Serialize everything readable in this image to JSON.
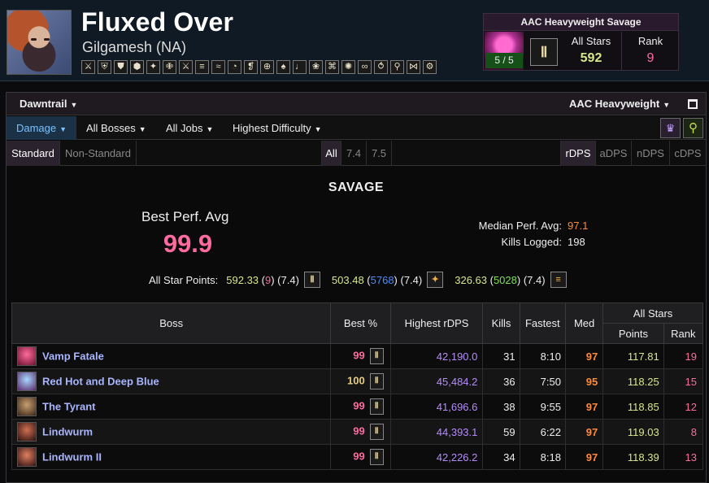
{
  "header": {
    "character_name": "Fluxed Over",
    "server": "Gilgamesh (NA)",
    "job_icons": [
      "⚔",
      "⛨",
      "⛊",
      "⬢",
      "✦",
      "✙",
      "⚔",
      "≡",
      "≈",
      "◔",
      "❡",
      "⊕",
      "♠",
      "♩",
      "❀",
      "⌘",
      "✺",
      "∞",
      "⥀",
      "⚲",
      "⋈",
      "⚙"
    ]
  },
  "stars_box": {
    "title": "AAC Heavyweight Savage",
    "progress": "5 / 5",
    "job_glyph": "Ⅱ",
    "all_stars_label": "All Stars",
    "all_stars_value": "592",
    "rank_label": "Rank",
    "rank_value": "9"
  },
  "filters": {
    "expansion": "Dawntrail",
    "zone": "AAC Heavyweight",
    "metric_tab": "Damage",
    "bosses": "All Bosses",
    "jobs": "All Jobs",
    "difficulty": "Highest Difficulty",
    "standard": "Standard",
    "non_standard": "Non-Standard",
    "patch_all": "All",
    "patch_74": "7.4",
    "patch_75": "7.5",
    "rdps": "rDPS",
    "adps": "aDPS",
    "ndps": "nDPS",
    "cdps": "cDPS"
  },
  "summary": {
    "difficulty_title": "SAVAGE",
    "best_perf_label": "Best Perf. Avg",
    "best_perf_value": "99.9",
    "median_label": "Median Perf. Avg:",
    "median_value": "97.1",
    "kills_label": "Kills Logged:",
    "kills_value": "198",
    "all_star_points_label": "All Star Points:",
    "all_star_points": [
      {
        "points": "592.33",
        "rank": "9",
        "patch": "(7.4)",
        "icon": "Ⅱ",
        "rank_color": "pink"
      },
      {
        "points": "503.48",
        "rank": "5768",
        "patch": "(7.4)",
        "icon": "✦",
        "rank_color": "blue"
      },
      {
        "points": "326.63",
        "rank": "5028",
        "patch": "(7.4)",
        "icon": "≡",
        "rank_color": "green"
      }
    ]
  },
  "table": {
    "headers": {
      "boss": "Boss",
      "best": "Best %",
      "highest": "Highest rDPS",
      "kills": "Kills",
      "fastest": "Fastest",
      "med": "Med",
      "all_stars": "All Stars",
      "points": "Points",
      "rank": "Rank"
    },
    "rows": [
      {
        "boss": "Vamp Fatale",
        "best": "99",
        "highest": "42,190.0",
        "kills": "31",
        "fastest": "8:10",
        "med": "97",
        "points": "117.81",
        "rank": "19"
      },
      {
        "boss": "Red Hot and Deep Blue",
        "best": "100",
        "highest": "45,484.2",
        "kills": "36",
        "fastest": "7:50",
        "med": "95",
        "points": "118.25",
        "rank": "15"
      },
      {
        "boss": "The Tyrant",
        "best": "99",
        "highest": "41,696.6",
        "kills": "38",
        "fastest": "9:55",
        "med": "97",
        "points": "118.85",
        "rank": "12"
      },
      {
        "boss": "Lindwurm",
        "best": "99",
        "highest": "44,393.1",
        "kills": "59",
        "fastest": "6:22",
        "med": "97",
        "points": "119.03",
        "rank": "8"
      },
      {
        "boss": "Lindwurm II",
        "best": "99",
        "highest": "42,226.2",
        "kills": "34",
        "fastest": "8:18",
        "med": "97",
        "points": "118.39",
        "rank": "13"
      }
    ]
  },
  "colors": {
    "accent_pink": "#ff6aa0",
    "gold": "#e5cc80",
    "points_green": "#d6e88a",
    "med_orange": "#ff8a3a",
    "rdps_purple": "#b48cff",
    "boss_link": "#a9b5ff",
    "tab_blue": "#7bc0ff"
  }
}
